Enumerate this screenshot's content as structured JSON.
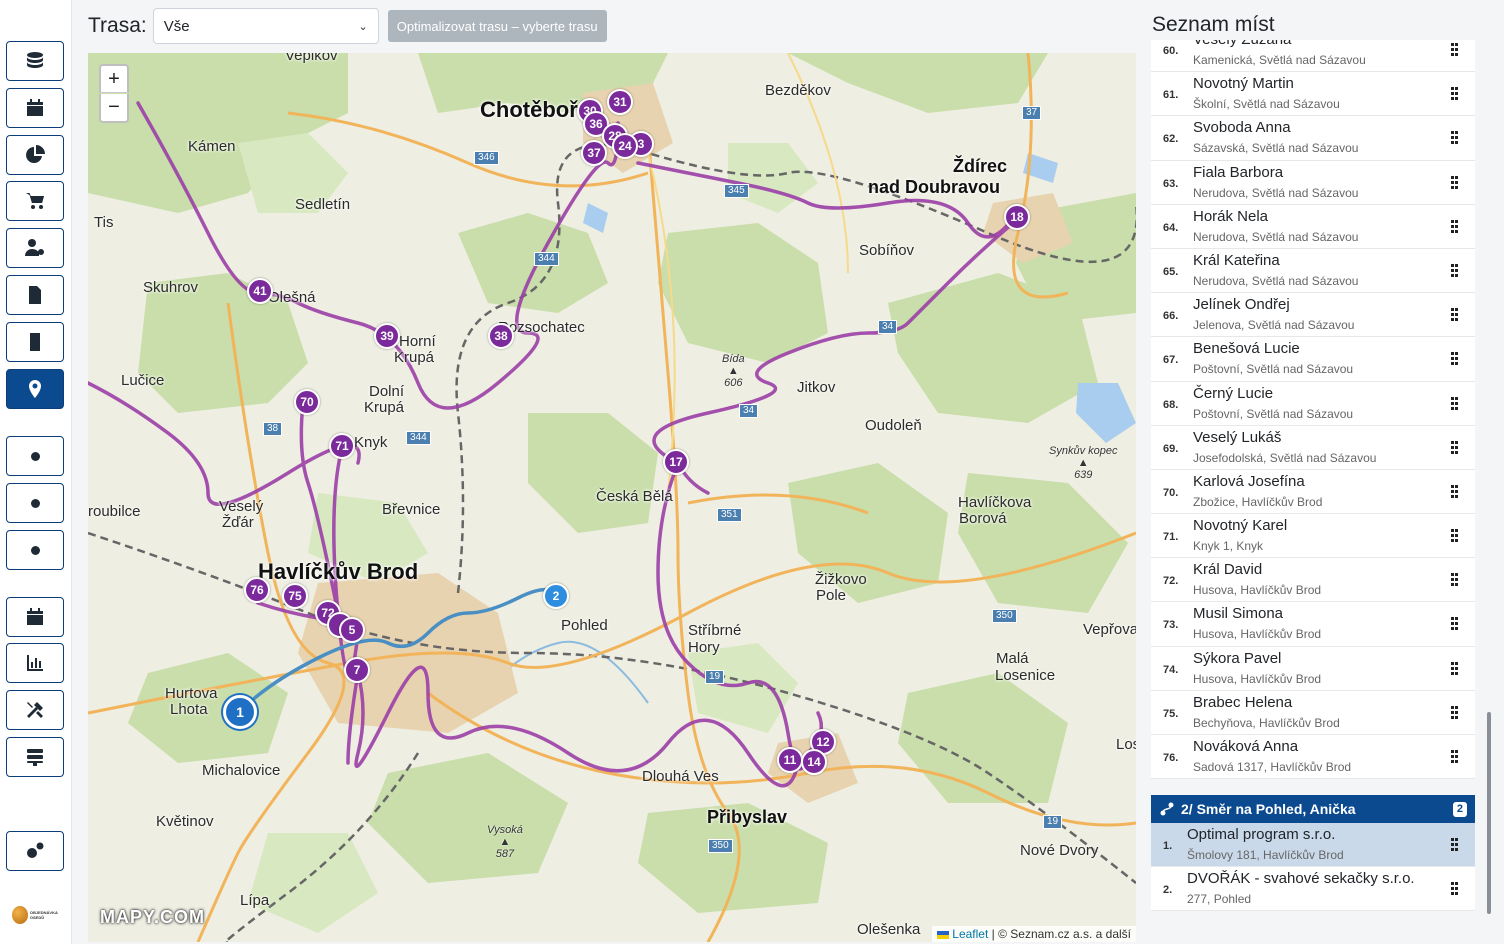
{
  "sidebar": {
    "items": [
      {
        "name": "sidebar-item-database",
        "icon": "database-icon"
      },
      {
        "name": "sidebar-item-calendar",
        "icon": "calendar-icon"
      },
      {
        "name": "sidebar-item-reports",
        "icon": "pie-chart-icon"
      },
      {
        "name": "sidebar-item-orders",
        "icon": "cart-icon"
      },
      {
        "name": "sidebar-item-users",
        "icon": "user-gear-icon"
      },
      {
        "name": "sidebar-item-invoices",
        "icon": "invoice-icon"
      },
      {
        "name": "sidebar-item-buildings",
        "icon": "building-icon"
      },
      {
        "name": "sidebar-item-map",
        "icon": "map-pin-icon",
        "active": true
      },
      {
        "name": "sidebar-item-dot-1",
        "icon": "dot-icon"
      },
      {
        "name": "sidebar-item-dot-2",
        "icon": "dot-icon"
      },
      {
        "name": "sidebar-item-dot-3",
        "icon": "dot-icon"
      },
      {
        "name": "sidebar-item-schedule",
        "icon": "calendar-icon"
      },
      {
        "name": "sidebar-item-stats",
        "icon": "bar-chart-icon"
      },
      {
        "name": "sidebar-item-tools",
        "icon": "tools-icon"
      },
      {
        "name": "sidebar-item-server",
        "icon": "server-icon"
      },
      {
        "name": "sidebar-item-settings",
        "icon": "gears-icon"
      }
    ],
    "logo_text": "OBJEDNÁVKA OSEDŮ"
  },
  "topbar": {
    "route_label": "Trasa:",
    "route_value": "Vše",
    "optimize_label": "Optimalizovat trasu – vyberte trasu"
  },
  "map": {
    "zoom_in": "+",
    "zoom_out": "−",
    "brand": "MAPY.COM",
    "attribution_leaflet": "Leaflet",
    "attribution_rest": "| © Seznam.cz a.s. a další",
    "towns": {
      "chotebor": "Chotěboř",
      "zdirec_1": "Ždírec",
      "zdirec_2": "nad Doubravou",
      "havlickuv_brod": "Havlíčkův Brod",
      "pribyslav": "Přibyslav",
      "vepikov": "Vepikov",
      "bezdekov": "Bezděkov",
      "kamen": "Kámen",
      "sedletin": "Sedletín",
      "tis": "Tis",
      "skuhrov": "Skuhrov",
      "olesna": "Olešná",
      "horni_krupa_1": "Horní",
      "horni_krupa_2": "Krupá",
      "dolni_krupa_1": "Dolní",
      "dolni_krupa_2": "Krupá",
      "rozsochatec": "Rozsochatec",
      "sobinov": "Sobíňov",
      "lucice": "Lučice",
      "knyk": "Knyk",
      "jitkov": "Jitkov",
      "oudolen": "Oudoleň",
      "vesely_zdar_1": "Veselý",
      "vesely_zdar_2": "Žďár",
      "brevnice": "Břevnice",
      "ceska_bela": "Česká Bělá",
      "havlickova_borova_1": "Havlíčkova",
      "havlickova_borova_2": "Borová",
      "troubilce": "roubilce",
      "zizkovo_pole_1": "Žižkovo",
      "zizkovo_pole_2": "Pole",
      "pohled": "Pohled",
      "stribrne_hory_1": "Stříbrné",
      "stribrne_hory_2": "Hory",
      "veprova": "Vepřova",
      "mala_losenice_1": "Malá",
      "mala_losenice_2": "Losenice",
      "hurtova_lhota_1": "Hurtova",
      "hurtova_lhota_2": "Lhota",
      "michalovice": "Michalovice",
      "dlouha_ves": "Dlouhá Ves",
      "kvetinov": "Květinov",
      "lipa": "Lípa",
      "nove_dvory": "Nové Dvory",
      "olesenka": "Olešenka",
      "los": "Los"
    },
    "peaks": {
      "bida_name": "Bída",
      "bida_alt": "606",
      "synkuv_name": "Synkův kopec",
      "synkuv_alt": "639",
      "vysoka_name": "Vysoká",
      "vysoka_alt": "587"
    },
    "road_numbers": [
      "346",
      "37",
      "345",
      "344",
      "34",
      "38",
      "344",
      "34",
      "351",
      "350",
      "19",
      "350",
      "19"
    ],
    "markers": [
      {
        "label": "31"
      },
      {
        "label": "30"
      },
      {
        "label": "36"
      },
      {
        "label": "28"
      },
      {
        "label": "37"
      },
      {
        "label": "24"
      },
      {
        "label": "3"
      },
      {
        "label": "18"
      },
      {
        "label": "41"
      },
      {
        "label": "39"
      },
      {
        "label": "38"
      },
      {
        "label": "70"
      },
      {
        "label": "71"
      },
      {
        "label": "17"
      },
      {
        "label": "76"
      },
      {
        "label": "75"
      },
      {
        "label": "72"
      },
      {
        "label": "5"
      },
      {
        "label": "7"
      },
      {
        "label": "12"
      },
      {
        "label": "11"
      },
      {
        "label": "14"
      },
      {
        "label": "2",
        "route": "blue"
      },
      {
        "label": "1",
        "route": "start"
      }
    ]
  },
  "panel": {
    "title": "Seznam míst",
    "items": [
      {
        "num": "60.",
        "name": "Veselý Zuzana",
        "addr": "Kamenická, Světlá nad Sázavou"
      },
      {
        "num": "61.",
        "name": "Novotný Martin",
        "addr": "Školní, Světlá nad Sázavou"
      },
      {
        "num": "62.",
        "name": "Svoboda Anna",
        "addr": "Sázavská, Světlá nad Sázavou"
      },
      {
        "num": "63.",
        "name": "Fiala Barbora",
        "addr": "Nerudova, Světlá nad Sázavou"
      },
      {
        "num": "64.",
        "name": "Horák Nela",
        "addr": "Nerudova, Světlá nad Sázavou"
      },
      {
        "num": "65.",
        "name": "Král Kateřina",
        "addr": "Nerudova, Světlá nad Sázavou"
      },
      {
        "num": "66.",
        "name": "Jelínek Ondřej",
        "addr": "Jelenova, Světlá nad Sázavou"
      },
      {
        "num": "67.",
        "name": "Benešová Lucie",
        "addr": "Poštovní, Světlá nad Sázavou"
      },
      {
        "num": "68.",
        "name": "Černý Lucie",
        "addr": "Poštovní, Světlá nad Sázavou"
      },
      {
        "num": "69.",
        "name": "Veselý Lukáš",
        "addr": "Josefodolská, Světlá nad Sázavou"
      },
      {
        "num": "70.",
        "name": "Karlová Josefína",
        "addr": "Zbožice, Havlíčkův Brod"
      },
      {
        "num": "71.",
        "name": "Novotný Karel",
        "addr": "Knyk 1, Knyk"
      },
      {
        "num": "72.",
        "name": "Král David",
        "addr": "Husova, Havlíčkův Brod"
      },
      {
        "num": "73.",
        "name": "Musil Simona",
        "addr": "Husova, Havlíčkův Brod"
      },
      {
        "num": "74.",
        "name": "Sýkora Pavel",
        "addr": "Husova, Havlíčkův Brod"
      },
      {
        "num": "75.",
        "name": "Brabec Helena",
        "addr": "Bechyňova, Havlíčkův Brod"
      },
      {
        "num": "76.",
        "name": "Nováková Anna",
        "addr": "Sadová 1317, Havlíčkův Brod"
      }
    ],
    "route": {
      "title": "2/ Směr na Pohled, Anička",
      "badge": "2",
      "items": [
        {
          "num": "1.",
          "name": "Optimal program s.r.o.",
          "addr": "Šmolovy 181, Havlíčkův Brod",
          "selected": true
        },
        {
          "num": "2.",
          "name": "DVOŘÁK - svahové sekačky s.r.o.",
          "addr": "277, Pohled"
        }
      ]
    }
  },
  "colors": {
    "accent": "#0b4a8f",
    "route_purple": "#9b3fa8",
    "route_blue": "#4a8fc4",
    "marker_purple": "#7b2a9c",
    "marker_blue": "#2f8de0"
  }
}
